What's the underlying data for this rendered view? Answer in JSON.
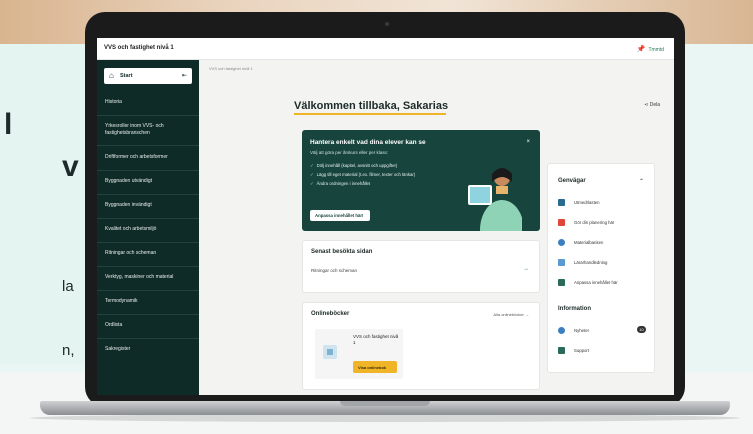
{
  "background": {
    "heading_fragment_1": "l",
    "heading_fragment_2": "v",
    "body_fragment_1": "la",
    "body_fragment_2": "n,"
  },
  "topbar": {
    "app_title": "VVS och fastighet nivå 1",
    "right_label": "Tmmtd"
  },
  "sidebar": {
    "start_label": "Start",
    "items": [
      "Historia",
      "Yrkesroller inom VVS- och fastighetsbranschen",
      "Driftformer och arbetsformer",
      "Byggnaden utvändigt",
      "Byggnaden invändigt",
      "Kvalitet och arbetsmiljö",
      "Ritningar och scheman",
      "Verktyg, maskiner och material",
      "Termodynamik",
      "Ordlista",
      "Sakregister"
    ]
  },
  "main": {
    "breadcrumb": "VVS och fastighet nivå 1",
    "welcome": "Välkommen tillbaka, Sakarias",
    "share_label": "Dela",
    "hero": {
      "title": "Hantera enkelt vad dina elever kan se",
      "subtitle": "Välj att göra per årskurs eller per klass:",
      "bullets": [
        "Dölj innehåll (kapitel, avsnitt och uppgifter)",
        "Lägg till eget material (t.ex. filmer, texter och länkar)",
        "Ändra ordningen i innehållet"
      ],
      "button": "Anpassa innehållet här!"
    },
    "recent": {
      "title": "Senast besökta sidan",
      "item": "Ritningar och scheman"
    },
    "books": {
      "title": "Onlineböcker",
      "more": "Alla onlineböcker",
      "book_name": "VVS och fastighet nivå 1",
      "book_button": "Visa onlinebok"
    },
    "shortcuts": {
      "title": "Genvägar",
      "items": [
        {
          "label": "Utmedrlasten",
          "color": "#2d6a8f"
        },
        {
          "label": "Gör din planering här",
          "color": "#e0463a"
        },
        {
          "label": "Materialbanken",
          "color": "#3a7fc0"
        },
        {
          "label": "Lärarhandledning",
          "color": "#5a9ad0"
        },
        {
          "label": "Anpassa innehållet här",
          "color": "#2a6a5a"
        }
      ]
    },
    "information": {
      "title": "Information",
      "items": [
        {
          "label": "Nyheter",
          "color": "#3a7fc0",
          "badge": "10"
        },
        {
          "label": "Support",
          "color": "#2a6a5a"
        }
      ]
    }
  }
}
